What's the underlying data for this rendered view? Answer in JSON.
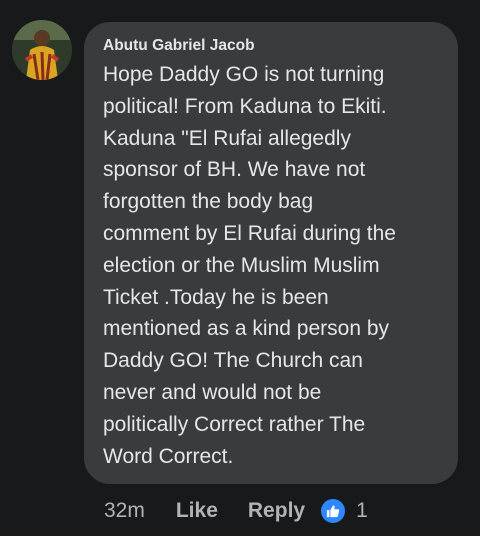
{
  "comment": {
    "author": "Abutu Gabriel Jacob",
    "text": "Hope Daddy GO is not turning\npolitical! From Kaduna to Ekiti.\nKaduna \"El Rufai  allegedly\nsponsor of BH. We have not\nforgotten  the body bag\ncomment by El Rufai during the\nelection or the Muslim Muslim\nTicket .Today he is been\nmentioned as  a kind person by\nDaddy GO! The Church can\nnever and would not be\npolitically Correct rather The\nWord Correct.",
    "timestamp": "32m",
    "like_label": "Like",
    "reply_label": "Reply",
    "reaction_icon": "thumbs-up-icon",
    "reaction_count": "1"
  },
  "colors": {
    "background": "#18191a",
    "bubble": "#3a3b3c",
    "text": "#e4e6eb",
    "secondary_text": "#b0b3b8",
    "like_blue": "#2d88ff"
  }
}
